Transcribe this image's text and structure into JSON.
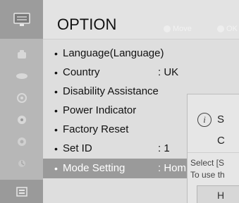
{
  "header": {
    "title": "OPTION",
    "hint_move": "Move",
    "hint_ok": "OK"
  },
  "sidebar": {
    "items": [
      {
        "icon": "setup-menu-icon"
      },
      {
        "icon": "picture-menu-icon"
      },
      {
        "icon": "sound-menu-icon"
      },
      {
        "icon": "time-menu-icon"
      },
      {
        "icon": "lock-menu-icon"
      },
      {
        "icon": "usb-menu-icon"
      },
      {
        "icon": "input-menu-icon"
      },
      {
        "icon": "option-menu-icon",
        "active": true
      }
    ]
  },
  "menu": {
    "items": [
      {
        "bullet": "•",
        "label": "Language(Language)",
        "value": ""
      },
      {
        "bullet": "•",
        "label": "Country",
        "value": ": UK"
      },
      {
        "bullet": "•",
        "label": "Disability Assistance",
        "value": ""
      },
      {
        "bullet": "•",
        "label": "Power Indicator",
        "value": ""
      },
      {
        "bullet": "•",
        "label": "Factory Reset",
        "value": ""
      },
      {
        "bullet": "•",
        "label": "Set ID",
        "value": ": 1"
      },
      {
        "bullet": "•",
        "label": "Mode Setting",
        "value": ": Hom",
        "selected": true
      }
    ]
  },
  "popup": {
    "info_glyph": "i",
    "line1": "S",
    "line2": "C",
    "desc1": "Select [S",
    "desc2": "To use th",
    "button_label": "H"
  },
  "colors": {
    "sidebar": "#b7b7b7",
    "selected": "#9a9a9a",
    "background": "#dedede"
  }
}
